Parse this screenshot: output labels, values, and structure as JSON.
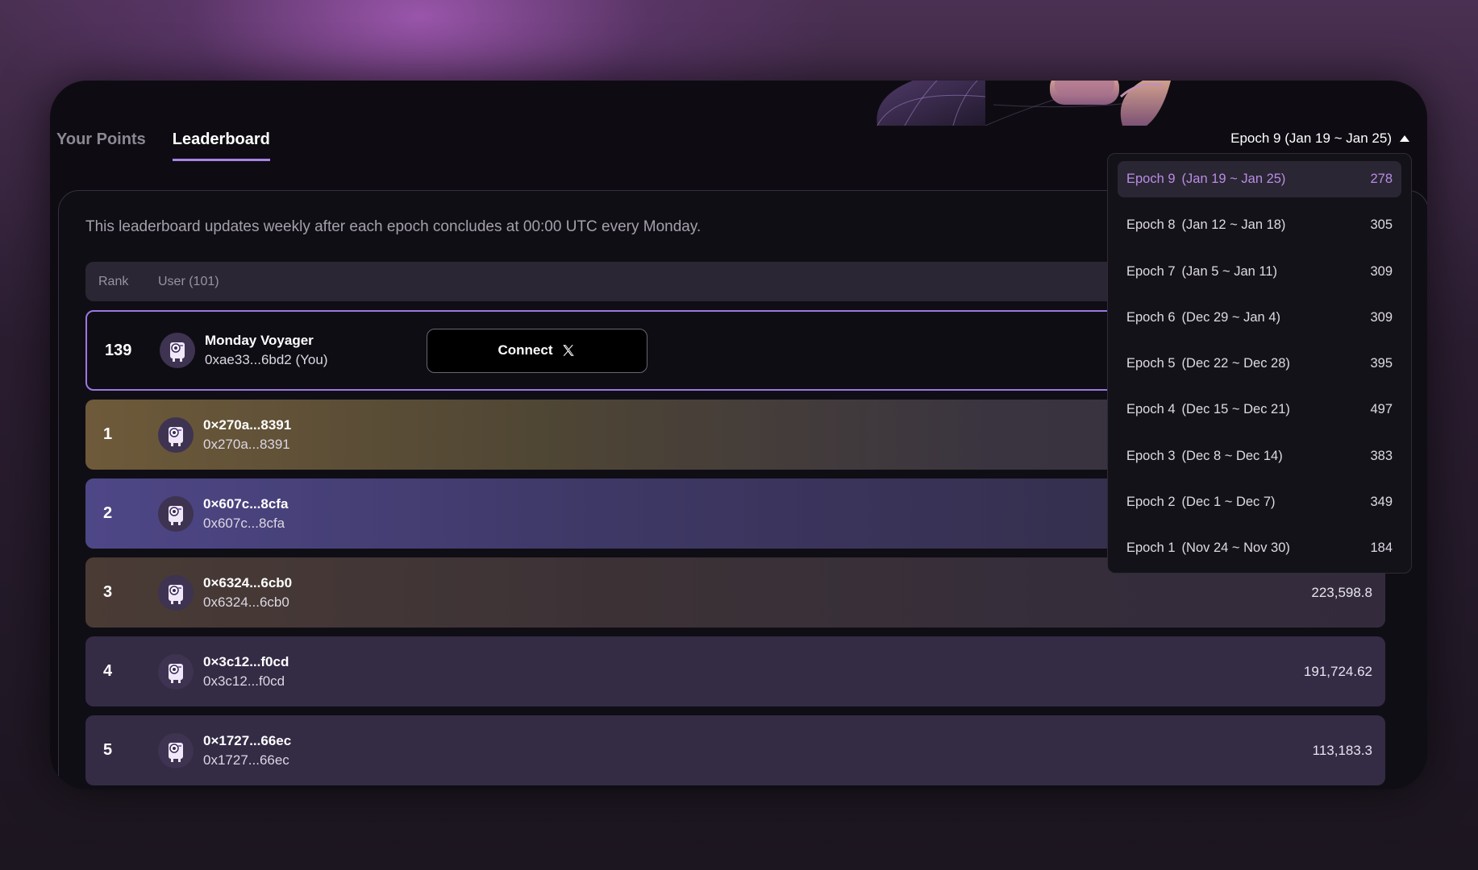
{
  "tabs": [
    {
      "label": "Your Points",
      "active": false
    },
    {
      "label": "Leaderboard",
      "active": true
    }
  ],
  "epoch_selector": {
    "label": "Epoch 9 (Jan 19 ~ Jan 25)"
  },
  "info_text": "This leaderboard updates weekly after each epoch concludes at 00:00 UTC every Monday.",
  "table_header": {
    "rank": "Rank",
    "user": "User (101)"
  },
  "me": {
    "rank": "139",
    "name": "Monday Voyager",
    "address": "0xae33...6bd2 (You)",
    "connect_label": "Connect"
  },
  "rows": [
    {
      "rank": "1",
      "name": "0×270a...8391",
      "address": "0x270a...8391",
      "points": ""
    },
    {
      "rank": "2",
      "name": "0×607c...8cfa",
      "address": "0x607c...8cfa",
      "points": ""
    },
    {
      "rank": "3",
      "name": "0×6324...6cb0",
      "address": "0x6324...6cb0",
      "points": "223,598.8"
    },
    {
      "rank": "4",
      "name": "0×3c12...f0cd",
      "address": "0x3c12...f0cd",
      "points": "191,724.62"
    },
    {
      "rank": "5",
      "name": "0×1727...66ec",
      "address": "0x1727...66ec",
      "points": "113,183.3"
    }
  ],
  "epochs": [
    {
      "name": "Epoch 9",
      "range": "(Jan 19 ~ Jan 25)",
      "count": "278",
      "selected": true
    },
    {
      "name": "Epoch 8",
      "range": "(Jan 12 ~ Jan 18)",
      "count": "305"
    },
    {
      "name": "Epoch 7",
      "range": "(Jan 5 ~ Jan 11)",
      "count": "309"
    },
    {
      "name": "Epoch 6",
      "range": "(Dec 29 ~ Jan 4)",
      "count": "309"
    },
    {
      "name": "Epoch 5",
      "range": "(Dec 22 ~ Dec 28)",
      "count": "395"
    },
    {
      "name": "Epoch 4",
      "range": "(Dec 15 ~ Dec 21)",
      "count": "497"
    },
    {
      "name": "Epoch 3",
      "range": "(Dec 8 ~ Dec 14)",
      "count": "383"
    },
    {
      "name": "Epoch 2",
      "range": "(Dec 1 ~ Dec 7)",
      "count": "349"
    },
    {
      "name": "Epoch 1",
      "range": "(Nov 24 ~ Nov 30)",
      "count": "184"
    }
  ],
  "colors": {
    "accent": "#a884e6",
    "selected_text": "#b88de6",
    "frame": "#0e0c12"
  }
}
